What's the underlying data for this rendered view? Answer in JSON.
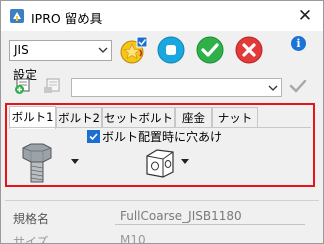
{
  "window": {
    "title": "IPRO 留め具",
    "close_glyph": "✕"
  },
  "standard": {
    "selected": "JIS"
  },
  "info_glyph": "i",
  "settings": {
    "label": "設定",
    "preset_value": ""
  },
  "tabs": [
    {
      "label": "ボルト1",
      "active": true
    },
    {
      "label": "ボルト2",
      "active": false
    },
    {
      "label": "セットボルト",
      "active": false
    },
    {
      "label": "座金",
      "active": false
    },
    {
      "label": "ナット",
      "active": false
    }
  ],
  "hole_option": {
    "label": "ボルト配置時に穴あけ",
    "checked": true
  },
  "properties": {
    "spec_label": "規格名",
    "spec_value": "FullCoarse_JISB1180",
    "size_label": "サイズ",
    "size_value": "M10"
  },
  "colors": {
    "highlight_border": "#e8141b",
    "ok": "#2fb14a",
    "cancel": "#e23a3a",
    "apply": "#1aa7e0",
    "info": "#1a74d8"
  }
}
